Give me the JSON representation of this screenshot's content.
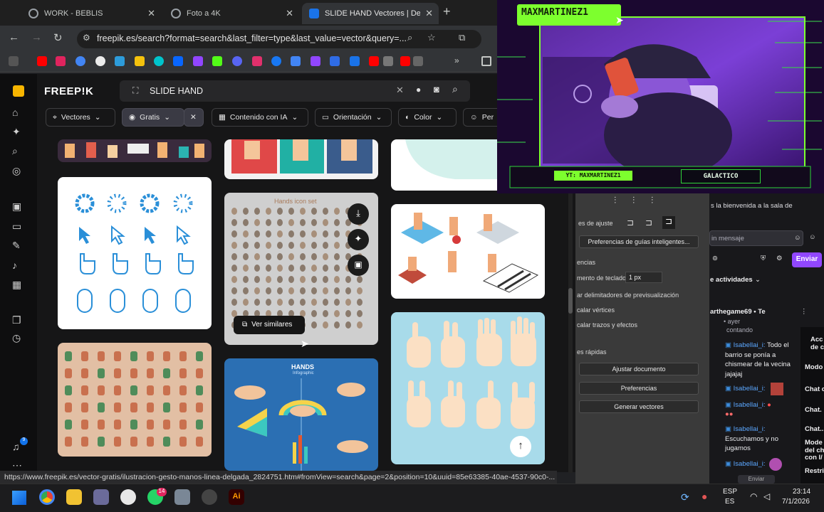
{
  "browser": {
    "tabs": [
      {
        "label": "WORK - BEBLIS"
      },
      {
        "label": "Foto a 4K"
      },
      {
        "label": "SLIDE HAND Vectores | Desc"
      }
    ],
    "url": "freepik.es/search?format=search&last_filter=type&last_value=vector&query=...",
    "status_url": "https://www.freepik.es/vector-gratis/ilustracion-gesto-manos-linea-delgada_2824751.htm#fromView=search&page=2&position=10&uuid=85e63385-40ae-4537-90c0-..."
  },
  "freepik": {
    "logo": "FREEP!K",
    "search_query": "SLIDE HAND",
    "filters": {
      "vectores": "Vectores",
      "gratis": "Gratis",
      "contenido_ia": "Contenido con IA",
      "orientacion": "Orientación",
      "color": "Color",
      "personas": "Per"
    },
    "card_hands_title": "Hands icon set",
    "card_infographic_title": "HANDS",
    "card_infographic_sub": "Infographic",
    "ver_similares": "Ver similares"
  },
  "stream": {
    "streamer_name": "MAXMARTINEZ1",
    "yt_label": "YT: MAXMARTINEZ1",
    "galactico_label": "GALACTICO"
  },
  "illustrator": {
    "ajuste_label": "es de ajuste",
    "pref_guias": "Preferencias de guías inteligentes...",
    "encias": "encias",
    "teclado_label": "mento de teclado:",
    "teclado_value": "1 px",
    "delimitadores": "ar delimitadores de previsualización",
    "vertices": "calar vértices",
    "trazos": "calar trazos y efectos",
    "rapidas": "es rápidas",
    "ajustar_doc": "Ajustar documento",
    "preferencias": "Preferencias",
    "generar": "Generar vectores"
  },
  "chat": {
    "welcome": "s la bienvenida a la sala de",
    "input_placeholder": "in mensaje",
    "send": "Enviar",
    "actividades": "e actividades",
    "activity_user": "arthegame69 • Te",
    "activity_sub": "• ayer",
    "contando": "contando",
    "messages": [
      {
        "user": "Isabellai_i:",
        "text": "Todo el barrio se ponía a chismear de la vecina jajajaj"
      },
      {
        "user": "Isabellai_i:",
        "text": ""
      },
      {
        "user": "Isabellai_i:",
        "text": ""
      },
      {
        "user": "Isabellai_i:",
        "text": "Escuchamos y no jugamos"
      },
      {
        "user": "Isabellai_i:",
        "text": ""
      }
    ],
    "right_col": [
      "Acc",
      "de c",
      "Modo",
      "Chat c",
      "Chat.",
      "Chat..",
      "Mode",
      "del ch",
      "con I/",
      "Restri"
    ],
    "enviar_bottom": "Enviar"
  },
  "taskbar": {
    "lang1": "ESP",
    "lang2": "ES",
    "time": "23:14",
    "date": "7/1/2026",
    "notif_badge": "14",
    "bell_badge": "9"
  },
  "colors": {
    "freepik_accent": "#1273eb",
    "cam_green": "#7dff2e",
    "twitch_purple": "#9147ff"
  }
}
